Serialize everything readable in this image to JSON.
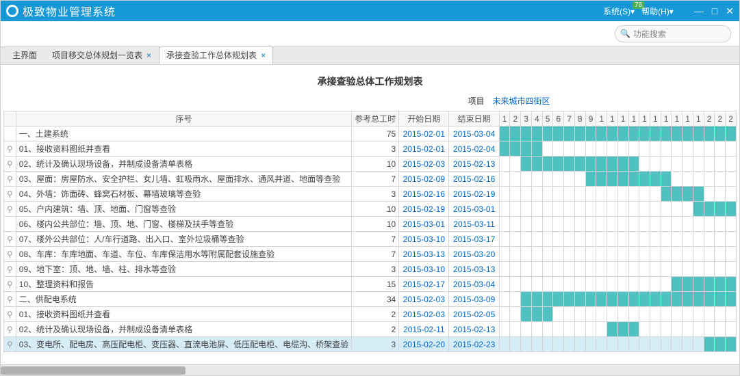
{
  "window": {
    "app_title": "极致物业管理系统",
    "menu_system": "系统(S)",
    "menu_help": "帮助(H)",
    "menu_chevron": "▾",
    "badge": "76"
  },
  "search": {
    "placeholder": "功能搜索",
    "icon": "🔍"
  },
  "tabs": [
    {
      "label": "主界面",
      "closable": false,
      "active": false
    },
    {
      "label": "项目移交总体规划一览表",
      "closable": true,
      "active": false
    },
    {
      "label": "承接查验工作总体规划表",
      "closable": true,
      "active": true
    }
  ],
  "report": {
    "title": "承接查验总体工作规划表",
    "project_label": "项目",
    "project_value": "未来城市四街区"
  },
  "grid": {
    "close_glyph": "×",
    "arrow_glyph": "▾",
    "headers": {
      "name": "序号",
      "hours": "参考总工时",
      "start": "开始日期",
      "end": "结束日期"
    },
    "gantt_day_headers": [
      "1",
      "2",
      "3",
      "4",
      "5",
      "6",
      "7",
      "8",
      "9",
      "1",
      "1",
      "1",
      "1",
      "1",
      "1",
      "1",
      "1",
      "1",
      "1",
      "2",
      "2",
      "2"
    ],
    "rows": [
      {
        "name": "一、土建系统",
        "hours": "75",
        "start": "2015-02-01",
        "end": "2015-03-04",
        "bars": [
          1,
          1,
          1,
          1,
          1,
          1,
          1,
          1,
          1,
          1,
          1,
          1,
          1,
          1,
          1,
          1,
          1,
          1,
          1,
          1,
          1,
          1
        ],
        "anchor": false,
        "selected": false
      },
      {
        "name": "01、接收资料图纸并查看",
        "hours": "3",
        "start": "2015-02-01",
        "end": "2015-02-04",
        "bars": [
          1,
          1,
          1,
          1,
          0,
          0,
          0,
          0,
          0,
          0,
          0,
          0,
          0,
          0,
          0,
          0,
          0,
          0,
          0,
          0,
          0,
          0
        ],
        "anchor": true,
        "selected": false
      },
      {
        "name": "02、统计及确认现场设备，并制成设备清单表格",
        "hours": "10",
        "start": "2015-02-03",
        "end": "2015-02-13",
        "bars": [
          0,
          0,
          1,
          1,
          1,
          1,
          1,
          1,
          1,
          1,
          1,
          1,
          1,
          0,
          0,
          0,
          0,
          0,
          0,
          0,
          0,
          0
        ],
        "anchor": true,
        "selected": false
      },
      {
        "name": "03、屋面：房屋防水、安全护栏、女儿墙、虹吸雨水、屋面排水、通风井道、地面等查验",
        "hours": "7",
        "start": "2015-02-09",
        "end": "2015-02-16",
        "bars": [
          0,
          0,
          0,
          0,
          0,
          0,
          0,
          0,
          1,
          1,
          1,
          1,
          1,
          1,
          1,
          1,
          0,
          0,
          0,
          0,
          0,
          0
        ],
        "anchor": true,
        "selected": false
      },
      {
        "name": "04、外墙：饰面砖、蜂窝石材板、幕墙玻璃等查验",
        "hours": "3",
        "start": "2015-02-16",
        "end": "2015-02-19",
        "bars": [
          0,
          0,
          0,
          0,
          0,
          0,
          0,
          0,
          0,
          0,
          0,
          0,
          0,
          0,
          0,
          1,
          1,
          1,
          1,
          0,
          0,
          0
        ],
        "anchor": true,
        "selected": false
      },
      {
        "name": "05、户内建筑：墙、顶、地面、门窗等查验",
        "hours": "10",
        "start": "2015-02-19",
        "end": "2015-03-01",
        "bars": [
          0,
          0,
          0,
          0,
          0,
          0,
          0,
          0,
          0,
          0,
          0,
          0,
          0,
          0,
          0,
          0,
          0,
          0,
          1,
          1,
          1,
          1
        ],
        "anchor": true,
        "selected": false
      },
      {
        "name": "06、楼内公共部位：墙、顶、地、门窗、楼梯及扶手等查验",
        "hours": "10",
        "start": "2015-03-01",
        "end": "2015-03-11",
        "bars": [
          0,
          0,
          0,
          0,
          0,
          0,
          0,
          0,
          0,
          0,
          0,
          0,
          0,
          0,
          0,
          0,
          0,
          0,
          0,
          0,
          0,
          0
        ],
        "anchor": false,
        "selected": false
      },
      {
        "name": "07、楼外公共部位：人/车行道路、出入口、室外垃圾桶等查验",
        "hours": "7",
        "start": "2015-03-10",
        "end": "2015-03-17",
        "bars": [
          0,
          0,
          0,
          0,
          0,
          0,
          0,
          0,
          0,
          0,
          0,
          0,
          0,
          0,
          0,
          0,
          0,
          0,
          0,
          0,
          0,
          0
        ],
        "anchor": true,
        "selected": false
      },
      {
        "name": "08、车库：车库地面、车道、车位、车库保洁用水等附属配套设施查验",
        "hours": "7",
        "start": "2015-03-13",
        "end": "2015-03-20",
        "bars": [
          0,
          0,
          0,
          0,
          0,
          0,
          0,
          0,
          0,
          0,
          0,
          0,
          0,
          0,
          0,
          0,
          0,
          0,
          0,
          0,
          0,
          0
        ],
        "anchor": true,
        "selected": false
      },
      {
        "name": "09、地下室：顶、地、墙、柱、排水等查验",
        "hours": "3",
        "start": "2015-03-10",
        "end": "2015-03-13",
        "bars": [
          0,
          0,
          0,
          0,
          0,
          0,
          0,
          0,
          0,
          0,
          0,
          0,
          0,
          0,
          0,
          0,
          0,
          0,
          0,
          0,
          0,
          0
        ],
        "anchor": true,
        "selected": false
      },
      {
        "name": "10、整理资料和报告",
        "hours": "15",
        "start": "2015-02-17",
        "end": "2015-03-04",
        "bars": [
          0,
          0,
          0,
          0,
          0,
          0,
          0,
          0,
          0,
          0,
          0,
          0,
          0,
          0,
          0,
          0,
          1,
          1,
          1,
          1,
          1,
          1
        ],
        "anchor": true,
        "selected": false
      },
      {
        "name": "二、供配电系统",
        "hours": "34",
        "start": "2015-02-03",
        "end": "2015-03-09",
        "bars": [
          0,
          0,
          1,
          1,
          1,
          1,
          1,
          1,
          1,
          1,
          1,
          1,
          1,
          1,
          1,
          1,
          1,
          1,
          1,
          1,
          1,
          1
        ],
        "anchor": true,
        "selected": false
      },
      {
        "name": "01、接收资料图纸并查看",
        "hours": "2",
        "start": "2015-02-03",
        "end": "2015-02-05",
        "bars": [
          0,
          0,
          1,
          1,
          1,
          0,
          0,
          0,
          0,
          0,
          0,
          0,
          0,
          0,
          0,
          0,
          0,
          0,
          0,
          0,
          0,
          0
        ],
        "anchor": true,
        "selected": false
      },
      {
        "name": "02、统计及确认现场设备，并制成设备清单表格",
        "hours": "2",
        "start": "2015-02-11",
        "end": "2015-02-13",
        "bars": [
          0,
          0,
          0,
          0,
          0,
          0,
          0,
          0,
          0,
          0,
          1,
          1,
          1,
          0,
          0,
          0,
          0,
          0,
          0,
          0,
          0,
          0
        ],
        "anchor": true,
        "selected": false
      },
      {
        "name": "03、变电所、配电房、高压配电柜、变压器、直流电池屏、低压配电柜、电缆沟、桥架查验",
        "hours": "3",
        "start": "2015-02-20",
        "end": "2015-02-23",
        "bars": [
          0,
          0,
          0,
          0,
          0,
          0,
          0,
          0,
          0,
          0,
          0,
          0,
          0,
          0,
          0,
          0,
          0,
          0,
          0,
          1,
          1,
          1
        ],
        "anchor": true,
        "selected": true
      }
    ]
  }
}
